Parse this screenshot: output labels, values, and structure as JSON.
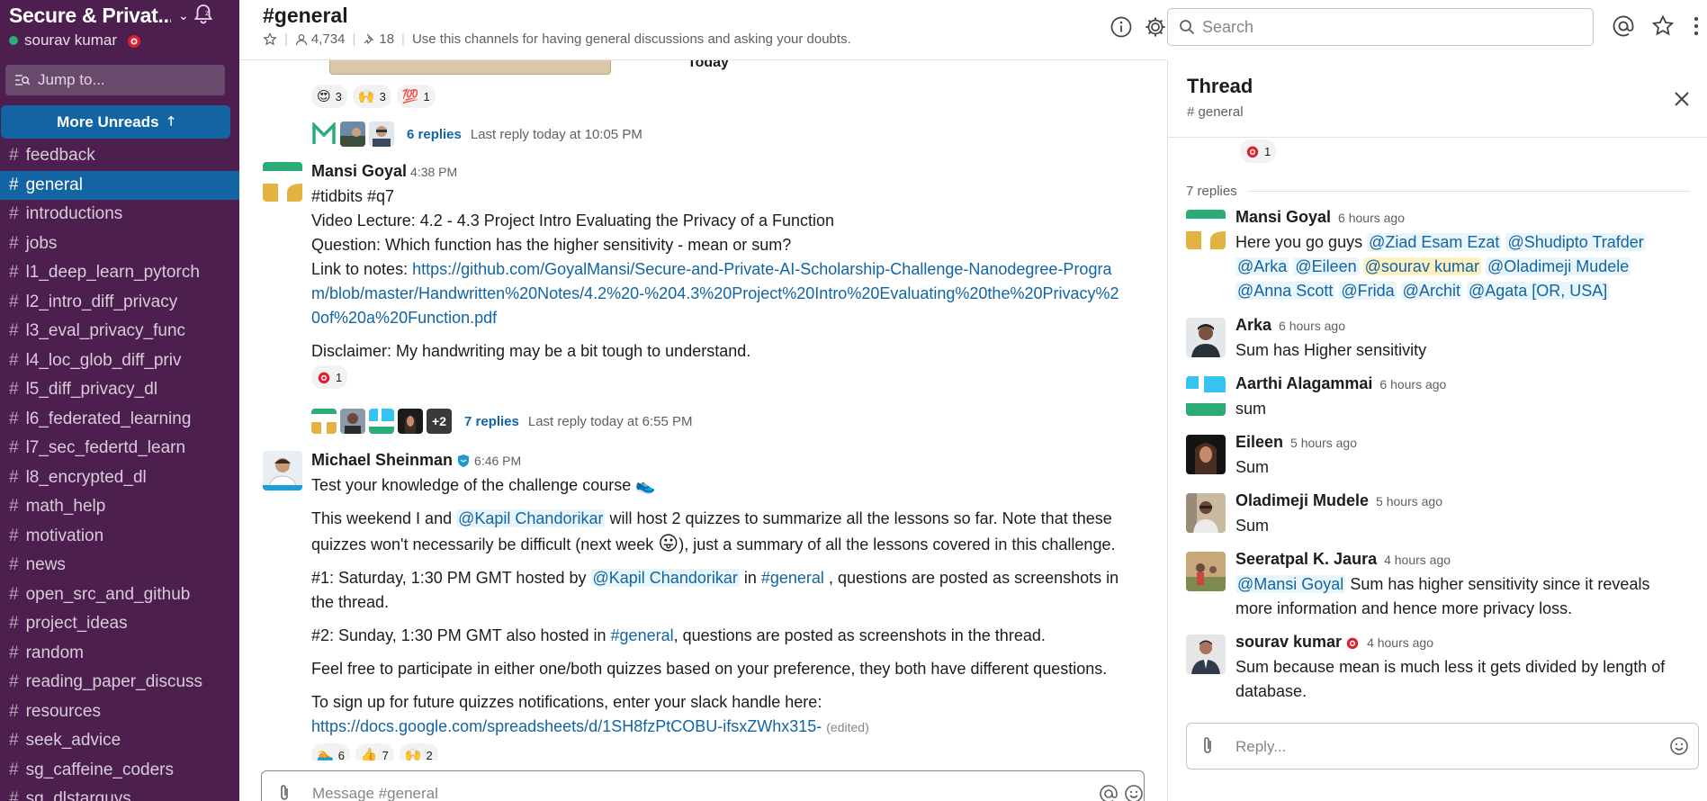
{
  "sidebar": {
    "workspace_name": "Secure & Privat...",
    "user_name": "sourav kumar",
    "jump_placeholder": "Jump to...",
    "more_unreads": "More Unreads",
    "channels": [
      {
        "name": "feedback",
        "active": false
      },
      {
        "name": "general",
        "active": true
      },
      {
        "name": "introductions",
        "active": false
      },
      {
        "name": "jobs",
        "active": false
      },
      {
        "name": "l1_deep_learn_pytorch",
        "active": false
      },
      {
        "name": "l2_intro_diff_privacy",
        "active": false
      },
      {
        "name": "l3_eval_privacy_func",
        "active": false
      },
      {
        "name": "l4_loc_glob_diff_priv",
        "active": false
      },
      {
        "name": "l5_diff_privacy_dl",
        "active": false
      },
      {
        "name": "l6_federated_learning",
        "active": false
      },
      {
        "name": "l7_sec_federtd_learn",
        "active": false
      },
      {
        "name": "l8_encrypted_dl",
        "active": false
      },
      {
        "name": "math_help",
        "active": false
      },
      {
        "name": "motivation",
        "active": false
      },
      {
        "name": "news",
        "active": false
      },
      {
        "name": "open_src_and_github",
        "active": false
      },
      {
        "name": "project_ideas",
        "active": false
      },
      {
        "name": "random",
        "active": false
      },
      {
        "name": "reading_paper_discuss",
        "active": false
      },
      {
        "name": "resources",
        "active": false
      },
      {
        "name": "seek_advice",
        "active": false
      },
      {
        "name": "sg_caffeine_coders",
        "active": false
      },
      {
        "name": "sg_dlstarguys",
        "active": false
      }
    ]
  },
  "header": {
    "title": "#general",
    "members": "4,734",
    "pins": "18",
    "topic": "Use this channels for having general discussions and asking your doubts."
  },
  "search": {
    "placeholder": "Search"
  },
  "feed": {
    "today_label": "Today",
    "top_reactions": [
      {
        "emoji": "😍",
        "count": "3"
      },
      {
        "emoji": "🙌",
        "count": "3"
      },
      {
        "emoji": "💯",
        "count": "1"
      }
    ],
    "top_thread": {
      "reply_count": "6 replies",
      "last_reply": "Last reply today at 10:05 PM"
    },
    "msg1": {
      "author": "Mansi Goyal",
      "time": "4:38 PM",
      "line1": "#tidbits #q7",
      "line2": "Video Lecture: 4.2 - 4.3 Project Intro Evaluating the Privacy of a Function",
      "line3": "Question: Which function has the higher sensitivity - mean or sum?",
      "link_label": "Link to notes: ",
      "link": "https://github.com/GoyalMansi/Secure-and-Private-AI-Scholarship-Challenge-Nanodegree-Program/blob/master/Handwritten%20Notes/4.2%20-%204.3%20Project%20Intro%20Evaluating%20the%20Privacy%20of%20a%20Function.pdf",
      "disclaimer": "Disclaimer: My handwriting may be a bit tough to understand.",
      "reaction_count": "1",
      "extra_count": "+2",
      "reply_count": "7 replies",
      "last_reply": "Last reply today at 6:55 PM"
    },
    "msg2": {
      "author": "Michael Sheinman",
      "time": "6:46 PM",
      "line1": "Test your knowledge of the challenge course",
      "p1_a": "This weekend I and ",
      "p1_mention": "@Kapil Chandorikar",
      "p1_b": " will host 2 quizzes to summarize all the lessons so far. Note that these quizzes won't necessarily be difficult (next week ",
      "p1_c": "), just a summary of all the lessons covered in this challenge.",
      "p2_a": "#1: Saturday, 1:30 PM GMT hosted by ",
      "p2_mention": "@Kapil Chandorikar",
      "p2_b": "  in ",
      "p2_channel": "#general",
      "p2_c": " , questions are posted as screenshots in the thread.",
      "p3_a": "#2: Sunday, 1:30 PM GMT also hosted in ",
      "p3_channel": "#general",
      "p3_b": ", questions are posted as screenshots in the thread.",
      "p4": "Feel free to participate in either one/both quizzes based on your preference, they both have different questions.",
      "p5": "To sign up for future quizzes notifications, enter your slack handle here:",
      "p5_link": "https://docs.google.com/spreadsheets/d/1SH8fzPtCOBU-ifsxZWhx315-",
      "edited": "(edited)",
      "reactions": [
        {
          "emoji": "🏊",
          "count": "6"
        },
        {
          "emoji": "👍",
          "count": "7"
        },
        {
          "emoji": "🙌",
          "count": "2"
        }
      ]
    }
  },
  "composer": {
    "placeholder": "Message #general"
  },
  "thread": {
    "title": "Thread",
    "channel": "# general",
    "top_reaction_count": "1",
    "replies_label": "7 replies",
    "reply_placeholder": "Reply...",
    "messages": [
      {
        "author": "Mansi Goyal",
        "time": "6 hours ago",
        "prefix": "Here you go guys ",
        "mentions": [
          "@Ziad Esam Ezat",
          "@Shudipto Trafder",
          "@Arka",
          "@Eileen",
          "@sourav kumar",
          "@Oladimeji Mudele",
          "@Anna Scott",
          "@Frida",
          "@Archit",
          "@Agata [OR, USA]"
        ]
      },
      {
        "author": "Arka",
        "time": "6 hours ago",
        "text": "Sum has Higher sensitivity"
      },
      {
        "author": "Aarthi Alagammai",
        "time": "6 hours ago",
        "text": "sum"
      },
      {
        "author": "Eileen",
        "time": "5 hours ago",
        "text": "Sum"
      },
      {
        "author": "Oladimeji Mudele",
        "time": "5 hours ago",
        "text": "Sum"
      },
      {
        "author": "Seeratpal K. Jaura",
        "time": "4 hours ago",
        "mention": "@Mansi Goyal",
        "text": " Sum has higher sensitivity since it reveals more information and hence more privacy loss."
      },
      {
        "author": "sourav kumar",
        "time": "4 hours ago",
        "text": "Sum because mean is much less it gets divided by length of database."
      }
    ]
  },
  "colors": {
    "sidebar_bg": "#4d1f4f",
    "active_channel": "#1264a3",
    "link": "#1264a3",
    "presence": "#2bac76"
  }
}
